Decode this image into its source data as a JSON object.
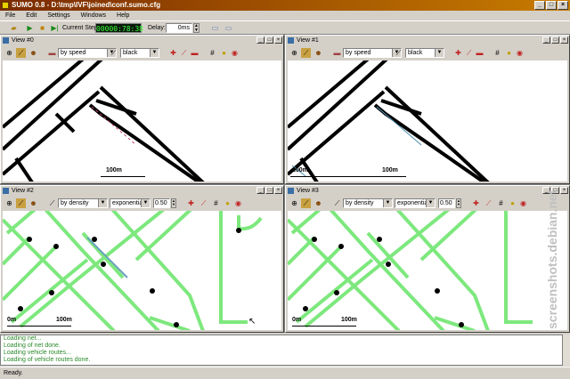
{
  "window": {
    "title": "SUMO 0.8 - D:\\tmp\\IVF\\joined\\conf.sumo.cfg"
  },
  "menu": [
    "File",
    "Edit",
    "Settings",
    "Windows",
    "Help"
  ],
  "toolbar": {
    "current_step_label": "Current Step:",
    "current_step_value": "00000:78:38",
    "delay_label": "Delay:",
    "delay_value": "0ms"
  },
  "views": [
    {
      "title": "View #0",
      "color_mode": "by speed",
      "color_value": "black",
      "scale": "100m"
    },
    {
      "title": "View #1",
      "color_mode": "by speed",
      "color_value": "black",
      "scale": "100m"
    },
    {
      "title": "View #2",
      "color_mode": "by density",
      "color_value": "exponential",
      "spinner": "0.50",
      "scale": "100m",
      "scale_zero": "0m"
    },
    {
      "title": "View #3",
      "color_mode": "by density",
      "color_value": "exponential",
      "spinner": "0.50",
      "scale": "100m",
      "scale_zero": "0m"
    }
  ],
  "log": [
    "Loading net...",
    "Loading of net done.",
    "Loading vehicle routes...",
    "Loading of vehicle routes done."
  ],
  "status": "Ready.",
  "watermark": "screenshots.debian.net",
  "colors": {
    "road_speed": "#000000",
    "road_density": "#7de87d",
    "title_start": "#7a2a00",
    "title_end": "#c87c00"
  }
}
